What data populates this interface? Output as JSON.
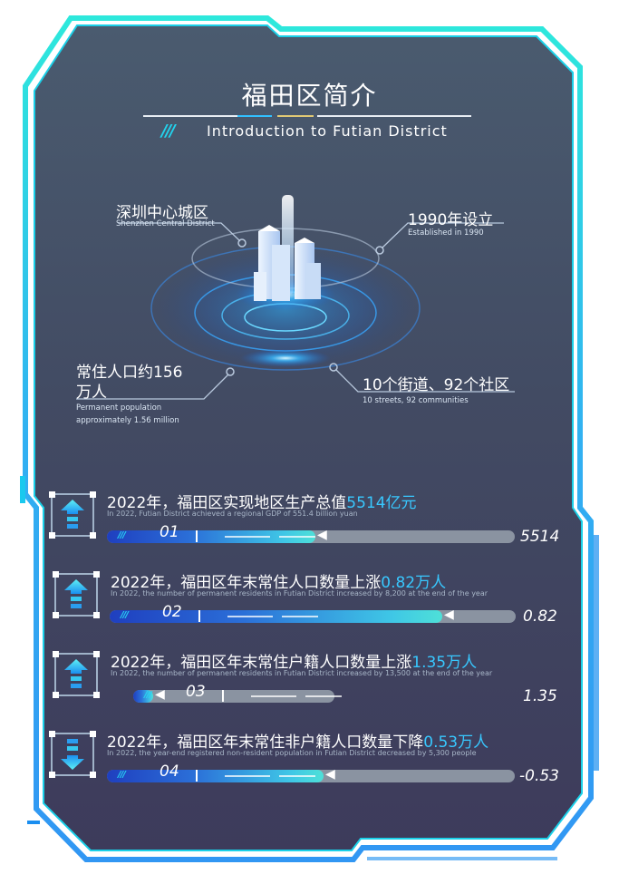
{
  "header": {
    "title": "福田区简介",
    "subtitle": "Introduction to Futian District",
    "slash_mark": "///"
  },
  "highlights": [
    {
      "cn": "深圳中心城区",
      "en": "Shenzhen Central District"
    },
    {
      "cn": "1990年设立",
      "en": "Established in 1990"
    },
    {
      "cn_line1": "常住人口约156",
      "cn_line2": "万人",
      "en_line1": "Permanent population",
      "en_line2": "approximately 1.56 million"
    },
    {
      "cn": "10个街道、92个社区",
      "en": "10 streets, 92 communities"
    }
  ],
  "stats": [
    {
      "index": "01",
      "direction": "up",
      "cn_prefix": "2022年，福田区实现地区生产总值",
      "cn_highlight": "5514亿元",
      "en": "In 2022, Futian District achieved a regional GDP of 551.4 billion yuan",
      "value": "5514",
      "bar_fraction": 0.51
    },
    {
      "index": "02",
      "direction": "up",
      "cn_prefix": "2022年，福田区年末常住人口数量上涨",
      "cn_highlight": "0.82万人",
      "en": "In 2022, the number of permanent residents in Futian District increased by 8,200 at the end of the year",
      "value": "0.82",
      "bar_fraction": 0.82
    },
    {
      "index": "03",
      "direction": "up",
      "cn_prefix": "2022年，福田区年末常住户籍人口数量上涨",
      "cn_highlight": "1.35万人",
      "en": "In 2022, the number of permanent residents in Futian District increased by 13,500 at the end of the year",
      "value": "1.35",
      "bar_fraction": 0.1
    },
    {
      "index": "04",
      "direction": "down",
      "cn_prefix": "2022年，福田区年末常住非户籍人口数量下降",
      "cn_highlight": "0.53万人",
      "en": "In 2022, the year-end registered non-resident population in Futian District decreased by 5,300 people",
      "value": "-0.53",
      "bar_fraction": 0.53
    }
  ],
  "colors": {
    "panel_top": "#45546a",
    "panel_bottom": "#3f3f5e",
    "frame_cyan": "#19d7e6",
    "frame_blue": "#1e8ff0",
    "highlight": "#38c8ff"
  },
  "icons": {
    "up": "arrow-up-icon",
    "down": "arrow-down-icon",
    "slash": "slash-stripes-icon",
    "marker": "arrow-left-icon"
  }
}
